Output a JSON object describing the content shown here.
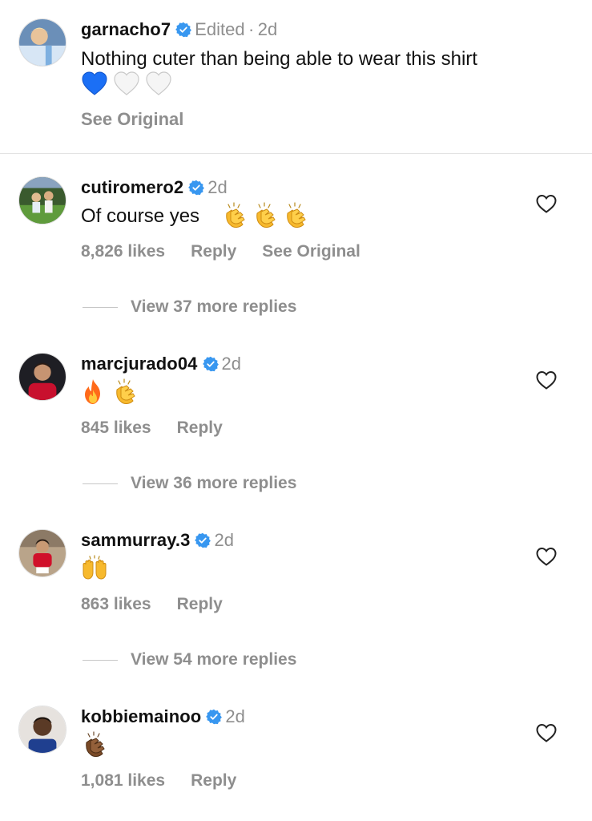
{
  "caption": {
    "username": "garnacho7",
    "edited": "Edited",
    "separator": "·",
    "time": "2d",
    "text": "Nothing cuter than being able to wear this shirt",
    "emojis": [
      "blue-heart",
      "white-heart",
      "white-heart"
    ],
    "see_original": "See Original"
  },
  "comments": [
    {
      "username": "cutiromero2",
      "time": "2d",
      "text": "Of course yes",
      "emojis": [
        "clapping-hands",
        "clapping-hands",
        "clapping-hands"
      ],
      "likes": "8,826 likes",
      "reply": "Reply",
      "see_original": "See Original",
      "view_replies": "View 37 more replies"
    },
    {
      "username": "marcjurado04",
      "time": "2d",
      "text": "",
      "emojis": [
        "fire",
        "clapping-hands"
      ],
      "likes": "845 likes",
      "reply": "Reply",
      "view_replies": "View 36 more replies"
    },
    {
      "username": "sammurray.3",
      "time": "2d",
      "text": "",
      "emojis": [
        "raising-hands"
      ],
      "likes": "863 likes",
      "reply": "Reply",
      "view_replies": "View 54 more replies"
    },
    {
      "username": "kobbiemainoo",
      "time": "2d",
      "text": "",
      "emojis": [
        "clapping-hands-dark"
      ],
      "likes": "1,081 likes",
      "reply": "Reply"
    }
  ],
  "colors": {
    "verified": "#3897f0",
    "muted": "#8e8e8e",
    "text": "#111111"
  }
}
